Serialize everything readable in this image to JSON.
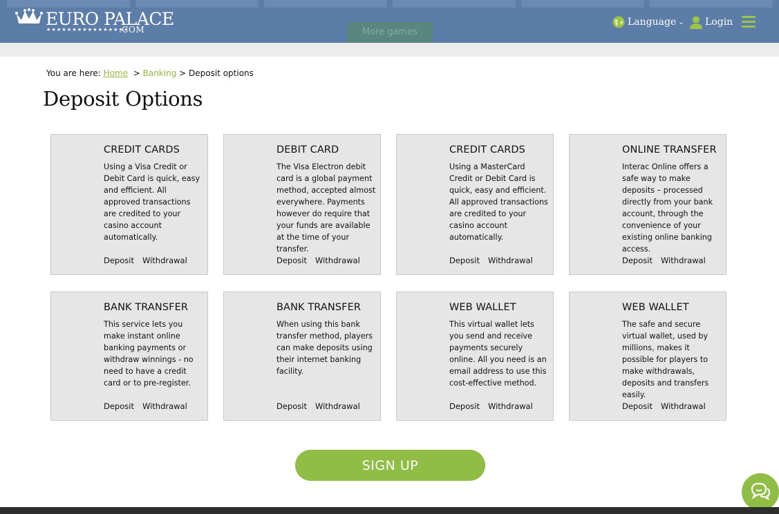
{
  "header": {
    "logo_main": "EURO PALACE",
    "logo_stars": "★★★★★★★★★★★★★★★★",
    "logo_domain": ".COM",
    "ghost_button": "More games",
    "language_label": "Language",
    "login_label": "Login",
    "icons": {
      "crown": "crown-icon",
      "globe": "globe-icon",
      "user": "user-icon",
      "menu": "hamburger-menu-icon"
    },
    "colors": {
      "bar": "#5c7da8",
      "accent": "#9bc347"
    }
  },
  "breadcrumb": {
    "prefix": "You are here:",
    "home": "Home",
    "separator": ">",
    "banking": "Banking",
    "current": "Deposit options"
  },
  "page": {
    "title": "Deposit Options"
  },
  "cards": [
    {
      "title": "CREDIT CARDS",
      "description": "Using a Visa Credit or Debit Card is quick, easy and efficient. All approved transactions are credited to your casino account automatically.",
      "deposit": "Deposit",
      "withdrawal": "Withdrawal"
    },
    {
      "title": "DEBIT CARD",
      "description": "The Visa Electron debit card is a global payment method, accepted almost everywhere. Payments however do require that your funds are available at the time of your transfer.",
      "deposit": "Deposit",
      "withdrawal": "Withdrawal"
    },
    {
      "title": "CREDIT CARDS",
      "description": "Using a MasterCard Credit or Debit Card is quick, easy and efficient. All approved transactions are credited to your casino account automatically.",
      "deposit": "Deposit",
      "withdrawal": "Withdrawal"
    },
    {
      "title": "ONLINE TRANSFER",
      "description": "Interac Online offers a safe way to make deposits – processed directly from your bank account, through the convenience of your existing online banking access.",
      "deposit": "Deposit",
      "withdrawal": "Withdrawal"
    },
    {
      "title": "BANK TRANSFER",
      "description": "This service lets you make instant online banking payments or withdraw winnings - no need to have a credit card or to pre-register.",
      "deposit": "Deposit",
      "withdrawal": "Withdrawal"
    },
    {
      "title": "BANK TRANSFER",
      "description": "When using this bank transfer method, players can make deposits using their internet banking facility.",
      "deposit": "Deposit",
      "withdrawal": "Withdrawal"
    },
    {
      "title": "WEB WALLET",
      "description": "This virtual wallet lets you send and receive payments securely online. All you need is an email address to use this cost-effective method.",
      "deposit": "Deposit",
      "withdrawal": "Withdrawal"
    },
    {
      "title": "WEB WALLET",
      "description": "The safe and secure virtual wallet, used by millions, makes it possible for players to make withdrawals, deposits and transfers easily.",
      "deposit": "Deposit",
      "withdrawal": "Withdrawal"
    }
  ],
  "signup": {
    "label": "SIGN UP",
    "color": "#8fbd45"
  },
  "chat": {
    "icon": "chat-bubbles-icon"
  }
}
